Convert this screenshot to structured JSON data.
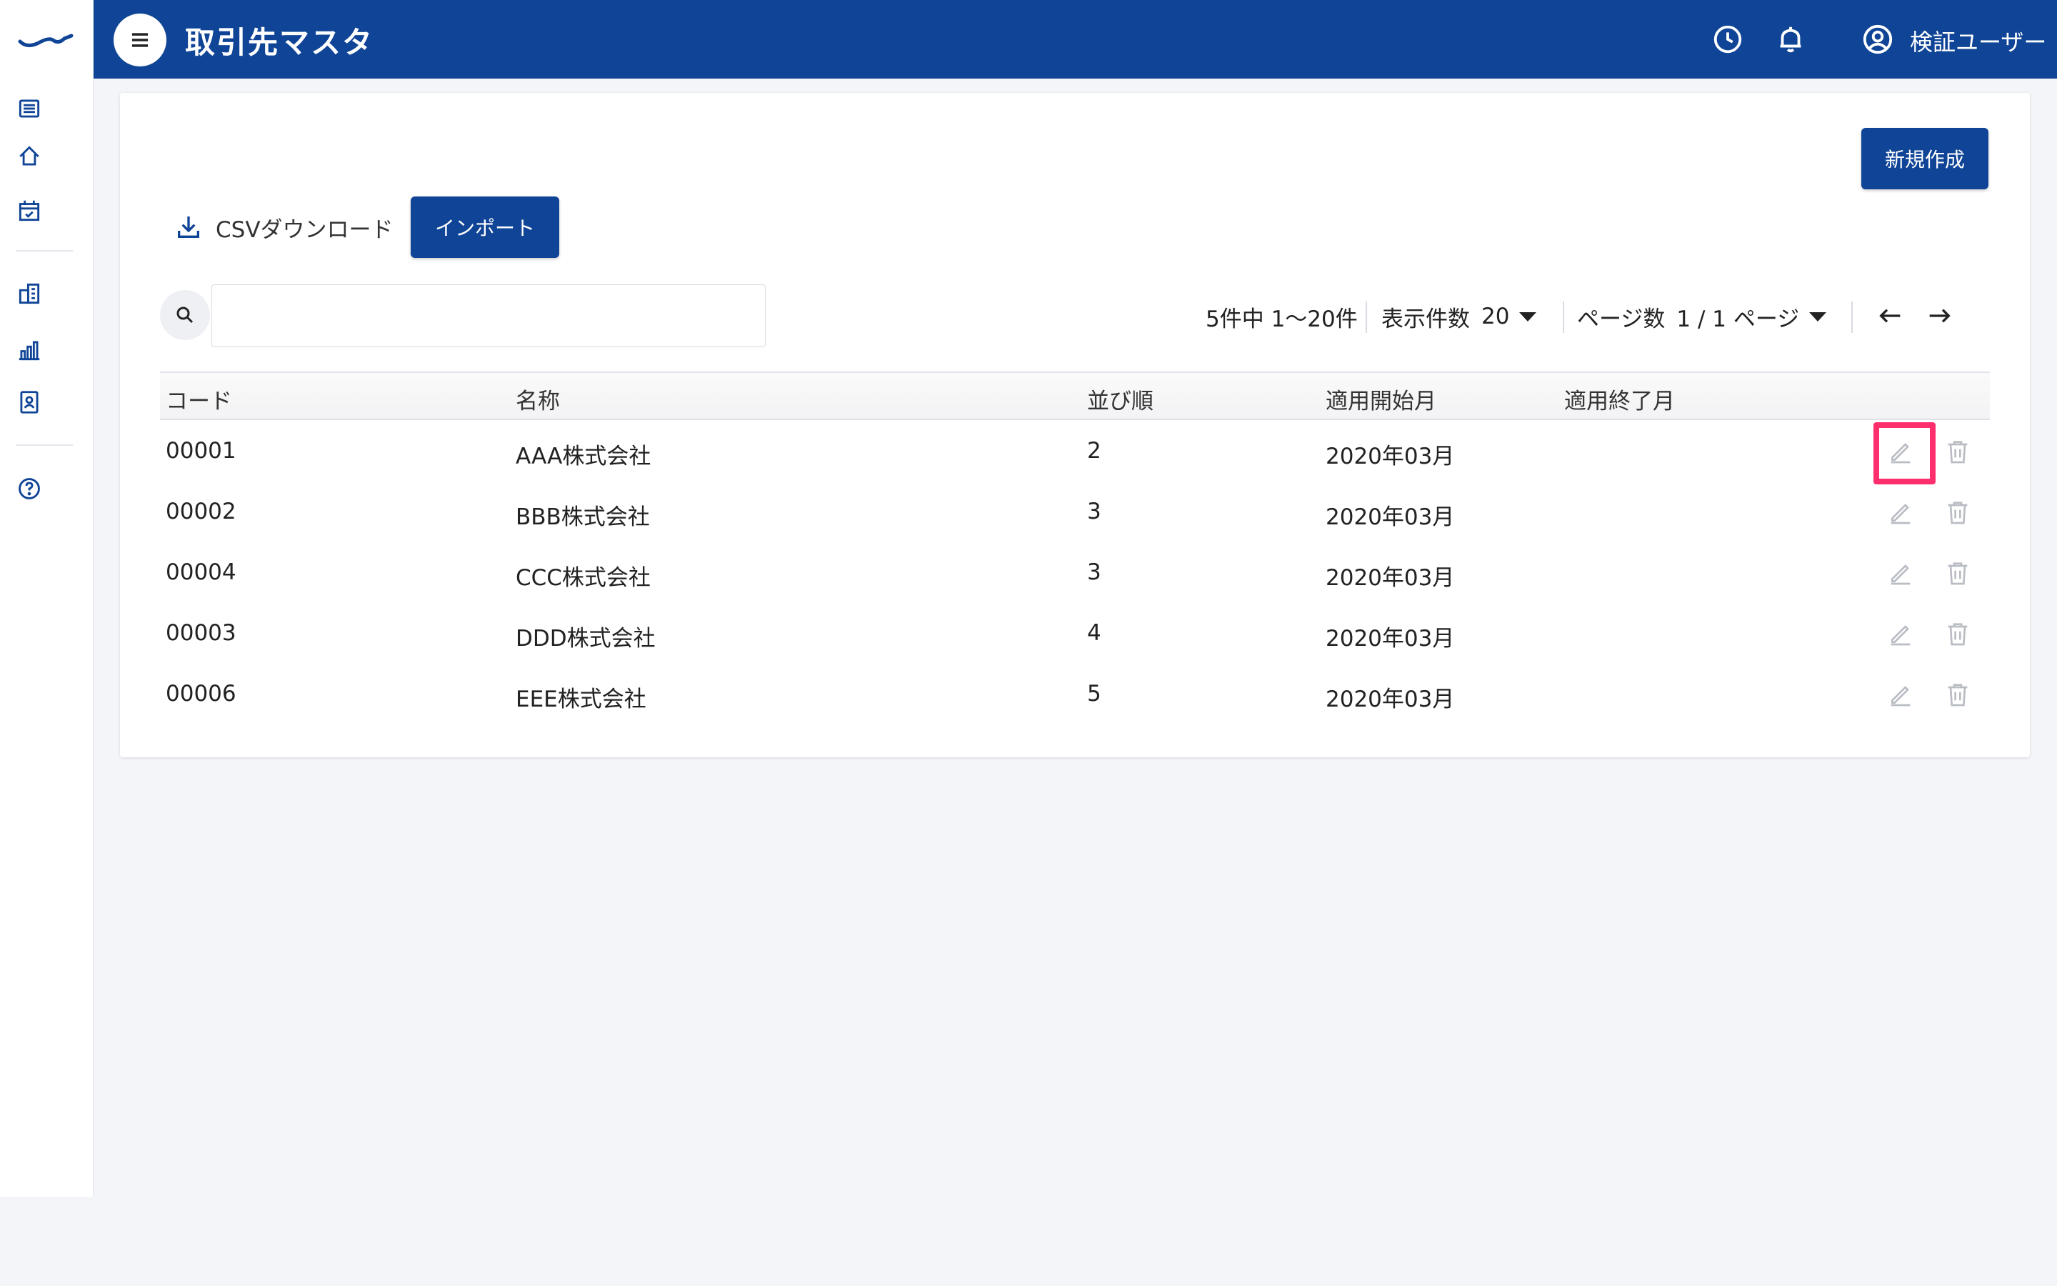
{
  "app": {
    "page_title": "取引先マスタ",
    "user_name": "検証ユーザー"
  },
  "colors": {
    "primary": "#0f4496",
    "highlight": "#ff2f6e",
    "icon_muted": "#b9bcc3"
  },
  "sidebar": {
    "items": [
      {
        "icon": "list-icon"
      },
      {
        "icon": "home-icon"
      },
      {
        "icon": "calendar-check-icon"
      },
      {
        "icon": "building-icon"
      },
      {
        "icon": "bar-chart-icon"
      },
      {
        "icon": "contact-card-icon"
      },
      {
        "icon": "help-icon"
      }
    ]
  },
  "toolbar": {
    "new_label": "新規作成",
    "csv_label": "CSVダウンロード",
    "import_label": "インポート",
    "search_placeholder": ""
  },
  "pager": {
    "range_text": "5件中 1〜20件",
    "per_page_label": "表示件数",
    "per_page_value": "20",
    "page_label": "ページ数",
    "page_value": "1 / 1 ページ",
    "prev": "←",
    "next": "→"
  },
  "table": {
    "headers": {
      "code": "コード",
      "name": "名称",
      "order": "並び順",
      "start": "適用開始月",
      "end": "適用終了月"
    },
    "rows": [
      {
        "code": "00001",
        "name": "AAA株式会社",
        "order": "2",
        "start": "2020年03月",
        "end": ""
      },
      {
        "code": "00002",
        "name": "BBB株式会社",
        "order": "3",
        "start": "2020年03月",
        "end": ""
      },
      {
        "code": "00004",
        "name": "CCC株式会社",
        "order": "3",
        "start": "2020年03月",
        "end": ""
      },
      {
        "code": "00003",
        "name": "DDD株式会社",
        "order": "4",
        "start": "2020年03月",
        "end": ""
      },
      {
        "code": "00006",
        "name": "EEE株式会社",
        "order": "5",
        "start": "2020年03月",
        "end": ""
      }
    ]
  }
}
